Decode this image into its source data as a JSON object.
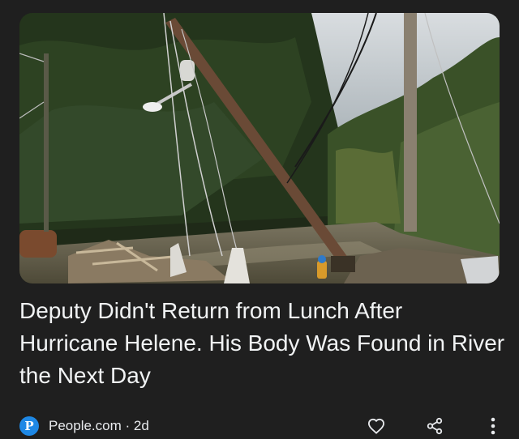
{
  "article": {
    "headline": "Deputy Didn't Return from Lunch After Hurricane Helene. His Body Was Found in River the Next Day",
    "source_initial": "P",
    "source_name": "People.com",
    "separator": " · ",
    "age": "2d"
  },
  "icons": {
    "source": "people-logo-icon",
    "like": "heart-icon",
    "share": "share-icon",
    "more": "more-vert-icon"
  },
  "colors": {
    "background": "#1f1f1f",
    "text": "#f1f3f4",
    "source_logo": "#1e88e5"
  }
}
